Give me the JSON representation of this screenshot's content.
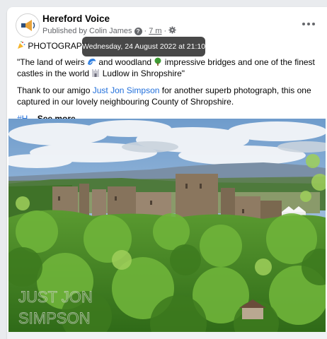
{
  "post": {
    "page_name": "Hereford Voice",
    "published_prefix": "Published by",
    "author": "Colin James",
    "separator": "·",
    "time": "7 m",
    "tooltip": "Wednesday, 24 August 2022 at 21:10",
    "title_prefix": "PHOTOGRAPH",
    "quote_part1": "\"The land of weirs",
    "quote_part2": "and woodland",
    "quote_part3": "impressive bridges and one of the finest castles in the world",
    "quote_part4": "Ludlow in Shropshire\"",
    "thanks_prefix": "Thank to our amigo",
    "thanks_link": "Just Jon Simpson",
    "thanks_suffix": "for another superb photograph, this one captured in our lovely neighbouring County of Shropshire.",
    "hashtag": "#H",
    "ellipsis": "...",
    "see_more": "See more",
    "watermark_line1": "JUST JON",
    "watermark_line2": "SIMPSON"
  },
  "icons": {
    "avatar": "megaphone-logo-icon",
    "info": "question-icon",
    "audience": "gear-icon",
    "menu": "more-horizontal-icon",
    "title_emoji": "party-popper-icon",
    "wave": "wave-icon",
    "tree": "tree-icon",
    "castle": "castle-icon"
  },
  "colors": {
    "link": "#216fdb",
    "meta": "#65676b",
    "tooltip_bg": "#282828"
  }
}
